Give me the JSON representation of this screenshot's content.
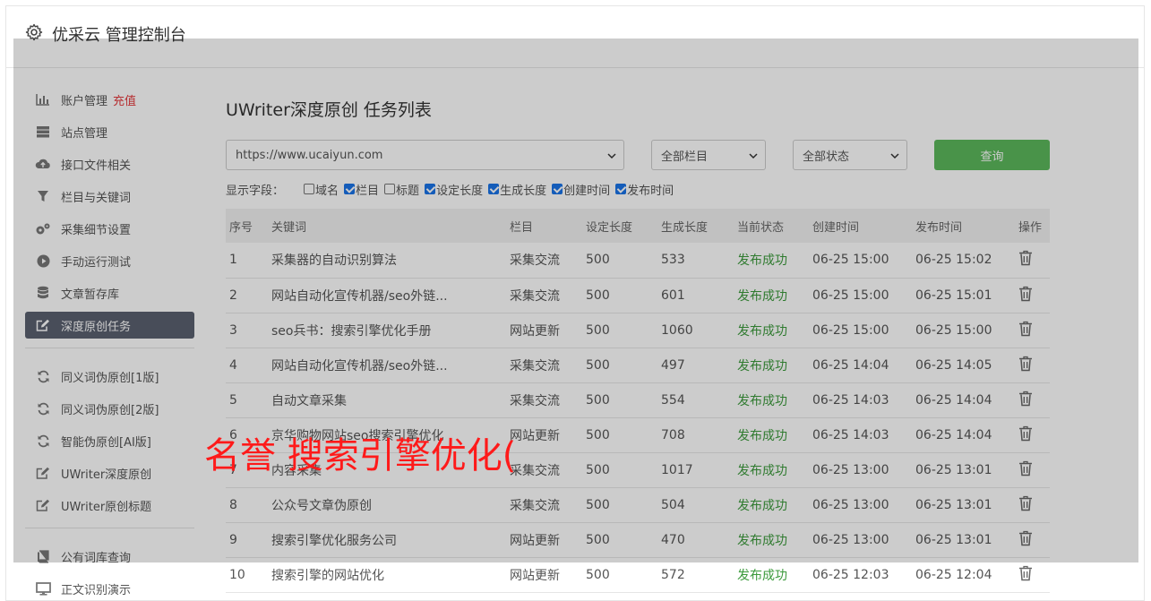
{
  "header": {
    "title": "优采云 管理控制台",
    "icon": "gear-icon"
  },
  "sidebar": {
    "group1": [
      {
        "label": "账户管理",
        "extra": "充值",
        "icon": "bar-chart-icon"
      },
      {
        "label": "站点管理",
        "icon": "server-icon"
      },
      {
        "label": "接口文件相关",
        "icon": "cloud-upload-icon"
      },
      {
        "label": "栏目与关键词",
        "icon": "filter-icon"
      },
      {
        "label": "采集细节设置",
        "icon": "cogs-icon"
      },
      {
        "label": "手动运行测试",
        "icon": "play-circle-icon"
      },
      {
        "label": "文章暂存库",
        "icon": "database-icon"
      },
      {
        "label": "深度原创任务",
        "icon": "edit-icon",
        "active": true
      }
    ],
    "group2": [
      {
        "label": "同义词伪原创[1版]",
        "icon": "refresh-icon"
      },
      {
        "label": "同义词伪原创[2版]",
        "icon": "refresh-icon"
      },
      {
        "label": "智能伪原创[AI版]",
        "icon": "refresh-icon"
      },
      {
        "label": "UWriter深度原创",
        "icon": "edit-icon"
      },
      {
        "label": "UWriter原创标题",
        "icon": "edit-icon"
      }
    ],
    "group3": [
      {
        "label": "公有词库查询",
        "icon": "book-icon"
      },
      {
        "label": "正文识别演示",
        "icon": "monitor-icon"
      }
    ]
  },
  "main": {
    "title": "UWriter深度原创 任务列表",
    "site_select": "https://www.ucaiyun.com",
    "column_select": "全部栏目",
    "status_select": "全部状态",
    "query_label": "查询",
    "fields_label": "显示字段：",
    "fields": [
      {
        "label": "域名",
        "checked": false
      },
      {
        "label": "栏目",
        "checked": true
      },
      {
        "label": "标题",
        "checked": false
      },
      {
        "label": "设定长度",
        "checked": true
      },
      {
        "label": "生成长度",
        "checked": true
      },
      {
        "label": "创建时间",
        "checked": true
      },
      {
        "label": "发布时间",
        "checked": true
      }
    ],
    "table": {
      "headers": [
        "序号",
        "关键词",
        "栏目",
        "设定长度",
        "生成长度",
        "当前状态",
        "创建时间",
        "发布时间",
        "操作"
      ],
      "rows": [
        [
          "1",
          "采集器的自动识别算法",
          "采集交流",
          "500",
          "533",
          "发布成功",
          "06-25 15:00",
          "06-25 15:02"
        ],
        [
          "2",
          "网站自动化宣传机器/seo外链...",
          "采集交流",
          "500",
          "601",
          "发布成功",
          "06-25 15:00",
          "06-25 15:01"
        ],
        [
          "3",
          "seo兵书：搜索引擎优化手册",
          "网站更新",
          "500",
          "1060",
          "发布成功",
          "06-25 15:00",
          "06-25 15:00"
        ],
        [
          "4",
          "网站自动化宣传机器/seo外链...",
          "采集交流",
          "500",
          "497",
          "发布成功",
          "06-25 14:04",
          "06-25 14:05"
        ],
        [
          "5",
          "自动文章采集",
          "采集交流",
          "500",
          "554",
          "发布成功",
          "06-25 14:03",
          "06-25 14:04"
        ],
        [
          "6",
          "京华购物网站seo搜索引擎优化",
          "网站更新",
          "500",
          "708",
          "发布成功",
          "06-25 14:03",
          "06-25 14:04"
        ],
        [
          "7",
          "内容采集",
          "采集交流",
          "500",
          "1017",
          "发布成功",
          "06-25 13:00",
          "06-25 13:01"
        ],
        [
          "8",
          "公众号文章伪原创",
          "采集交流",
          "500",
          "504",
          "发布成功",
          "06-25 13:00",
          "06-25 13:01"
        ],
        [
          "9",
          "搜索引擎优化服务公司",
          "网站更新",
          "500",
          "470",
          "发布成功",
          "06-25 13:00",
          "06-25 13:01"
        ],
        [
          "10",
          "搜索引擎的网站优化",
          "网站更新",
          "500",
          "572",
          "发布成功",
          "06-25 12:03",
          "06-25 12:04"
        ]
      ]
    }
  },
  "watermark": "名誉 搜索引擎优化(",
  "colors": {
    "active_bg": "#5a6170",
    "query_btn": "#5cb85c",
    "status_ok": "#3c9a3c",
    "recharge": "#e4393c",
    "watermark": "#ff1a1a"
  }
}
